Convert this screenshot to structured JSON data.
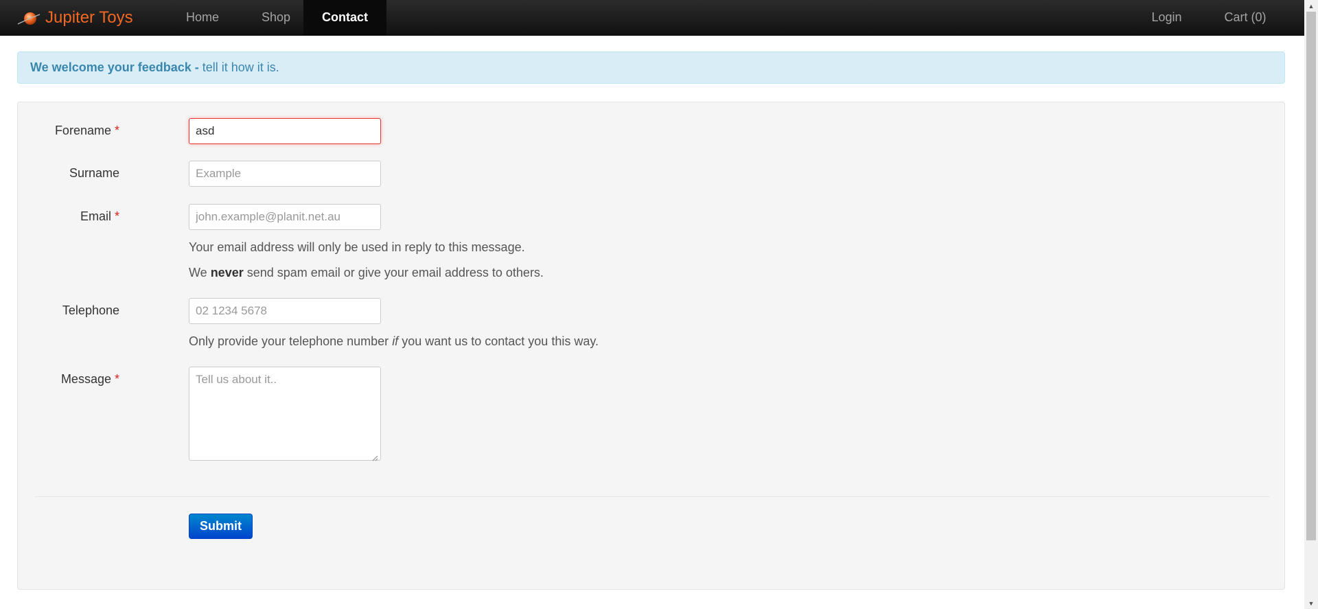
{
  "navbar": {
    "brand": "Jupiter Toys",
    "items": [
      {
        "label": "Home"
      },
      {
        "label": "Shop"
      },
      {
        "label": "Contact",
        "active": true
      }
    ],
    "login": "Login",
    "cart": "Cart (0)"
  },
  "alert": {
    "strong": "We welcome your feedback -",
    "text": " tell it how it is."
  },
  "form": {
    "forename": {
      "label": "Forename",
      "required_mark": "*",
      "value": "asd",
      "placeholder": ""
    },
    "surname": {
      "label": "Surname",
      "placeholder": "Example"
    },
    "email": {
      "label": "Email",
      "required_mark": "*",
      "placeholder": "john.example@planit.net.au",
      "help1": "Your email address will only be used in reply to this message.",
      "help2_pre": "We ",
      "help2_bold": "never",
      "help2_post": " send spam email or give your email address to others."
    },
    "telephone": {
      "label": "Telephone",
      "placeholder": "02 1234 5678",
      "help_pre": "Only provide your telephone number ",
      "help_em": "if",
      "help_post": " you want us to contact you this way."
    },
    "message": {
      "label": "Message",
      "required_mark": "*",
      "placeholder": "Tell us about it.."
    },
    "submit_label": "Submit"
  },
  "colors": {
    "brand": "#f26722",
    "alert_text": "#3a87ad",
    "alert_bg": "#d9edf7",
    "required": "#d9251d",
    "primary_button": "#0055cc"
  }
}
